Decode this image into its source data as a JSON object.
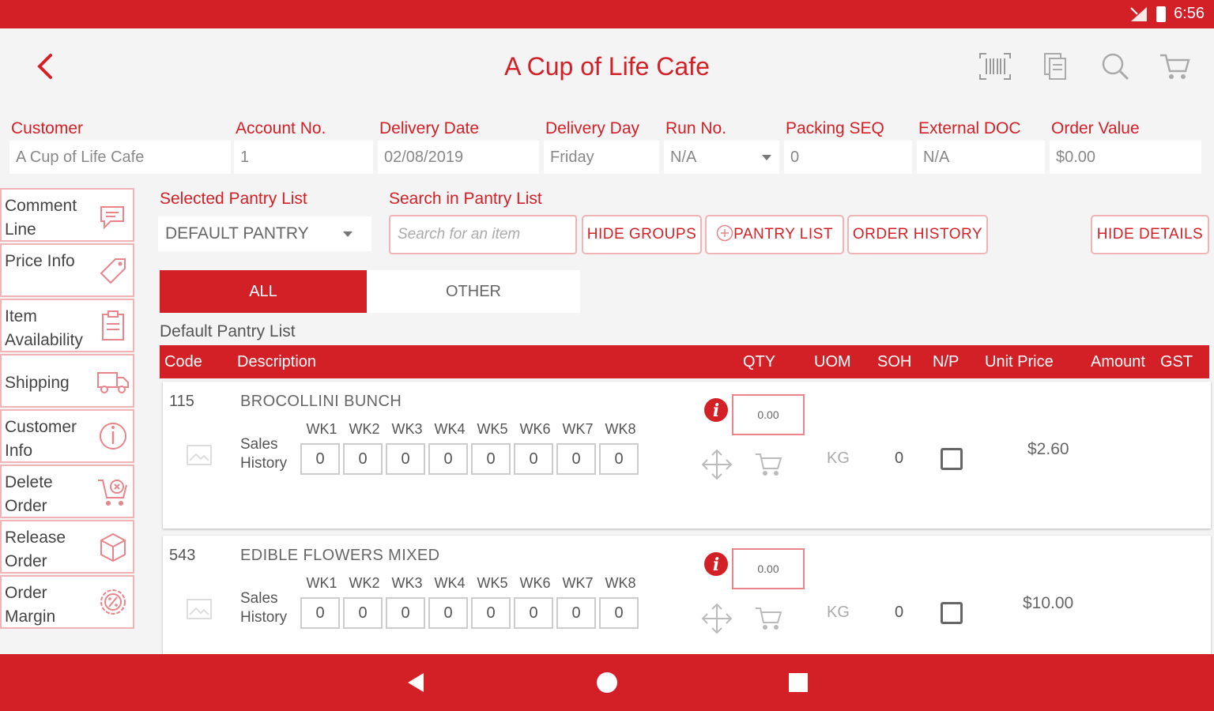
{
  "status_bar": {
    "time": "6:56"
  },
  "header": {
    "title": "A Cup of Life Cafe"
  },
  "order_fields": [
    {
      "label": "Customer",
      "value": "A Cup of Life Cafe"
    },
    {
      "label": "Account No.",
      "value": "1"
    },
    {
      "label": "Delivery Date",
      "value": "02/08/2019"
    },
    {
      "label": "Delivery Day",
      "value": "Friday"
    },
    {
      "label": "Run No.",
      "value": "N/A"
    },
    {
      "label": "Packing SEQ",
      "value": "0"
    },
    {
      "label": "External DOC",
      "value": "N/A"
    },
    {
      "label": "Order Value",
      "value": "$0.00"
    }
  ],
  "sidebar": {
    "items": [
      {
        "label": "Comment Line",
        "icon": "comment-icon"
      },
      {
        "label": "Price Info",
        "icon": "price-tag-icon"
      },
      {
        "label": "Item Availability",
        "icon": "clipboard-icon"
      },
      {
        "label": "Shipping",
        "icon": "truck-icon"
      },
      {
        "label": "Customer Info",
        "icon": "info-circle-icon"
      },
      {
        "label": "Delete Order",
        "icon": "cart-delete-icon"
      },
      {
        "label": "Release Order",
        "icon": "box-icon"
      },
      {
        "label": "Order Margin",
        "icon": "percent-gear-icon"
      }
    ]
  },
  "pantry": {
    "selected_label": "Selected Pantry List",
    "selected_value": "DEFAULT PANTRY",
    "search_label": "Search in Pantry List",
    "search_placeholder": "Search for an item",
    "hide_groups": "HIDE GROUPS",
    "pantry_list": "PANTRY LIST",
    "order_history": "ORDER HISTORY",
    "hide_details": "HIDE DETAILS",
    "tabs": [
      "ALL",
      "OTHER"
    ],
    "list_title": "Default Pantry List"
  },
  "table": {
    "columns": [
      "Code",
      "Description",
      "QTY",
      "UOM",
      "SOH",
      "N/P",
      "Unit Price",
      "Amount",
      "GST"
    ],
    "week_labels": [
      "WK1",
      "WK2",
      "WK3",
      "WK4",
      "WK5",
      "WK6",
      "WK7",
      "WK8"
    ],
    "sales_history_label": "Sales History",
    "rows": [
      {
        "code": "115",
        "description": "BROCOLLINI BUNCH",
        "qty": "0.00",
        "uom": "KG",
        "soh": "0",
        "unit_price": "$2.60",
        "history": [
          "0",
          "0",
          "0",
          "0",
          "0",
          "0",
          "0",
          "0"
        ]
      },
      {
        "code": "543",
        "description": "EDIBLE FLOWERS MIXED",
        "qty": "0.00",
        "uom": "KG",
        "soh": "0",
        "unit_price": "$10.00",
        "history": [
          "0",
          "0",
          "0",
          "0",
          "0",
          "0",
          "0",
          "0"
        ]
      }
    ]
  },
  "colors": {
    "brand": "#d32027",
    "border_light": "#f0b4b6"
  }
}
